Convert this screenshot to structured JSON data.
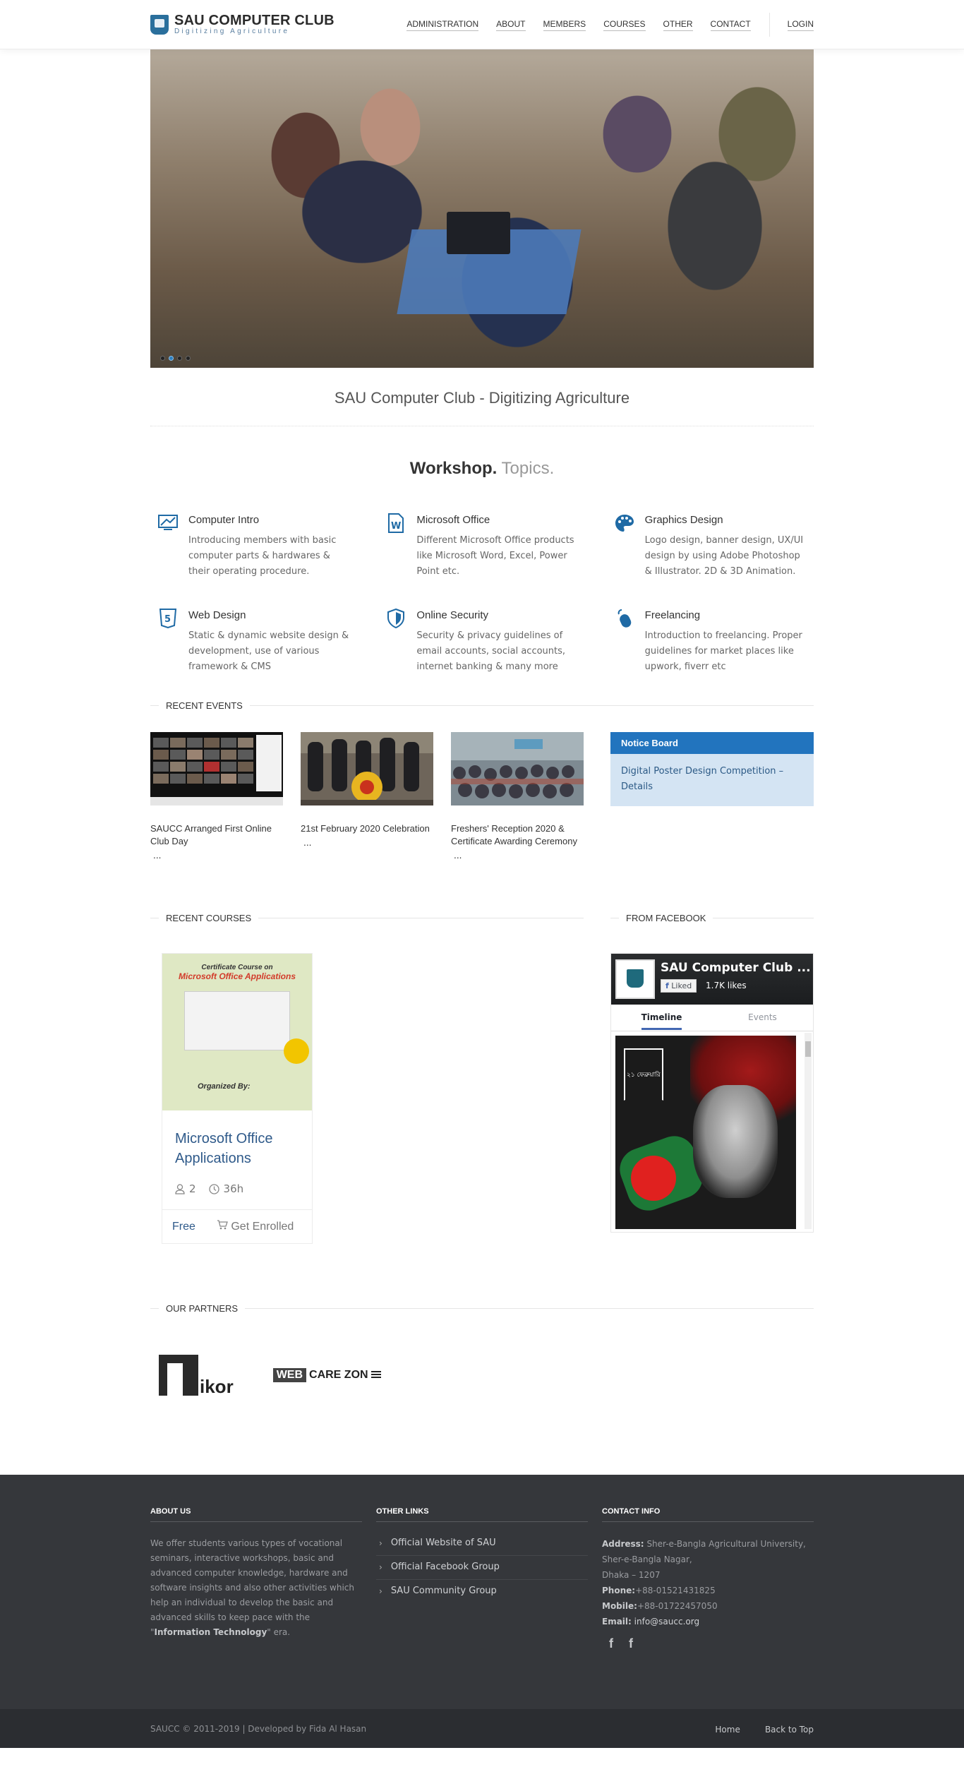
{
  "header": {
    "logo_title": "SAU COMPUTER CLUB",
    "logo_subtitle": "Digitizing Agriculture",
    "nav": [
      "ADMINISTRATION",
      "ABOUT",
      "MEMBERS",
      "COURSES",
      "OTHER",
      "CONTACT"
    ],
    "login": "LOGIN"
  },
  "hero": {
    "slide_count": 4,
    "active_slide": 2,
    "tagline": "SAU Computer Club - Digitizing Agriculture"
  },
  "workshop": {
    "title_bold": "Workshop.",
    "title_light": "Topics.",
    "topics": [
      {
        "icon": "monitor-icon",
        "title": "Computer Intro",
        "desc": "Introducing members with basic computer parts & hardwares & their operating procedure."
      },
      {
        "icon": "word-document-icon",
        "title": "Microsoft Office",
        "desc": "Different Microsoft Office products like Microsoft Word, Excel, Power Point etc."
      },
      {
        "icon": "palette-icon",
        "title": "Graphics Design",
        "desc": "Logo design, banner design, UX/UI design by using Adobe Photoshop & Illustrator. 2D & 3D Animation."
      },
      {
        "icon": "html5-icon",
        "title": "Web Design",
        "desc": "Static & dynamic website design & development, use of various framework & CMS"
      },
      {
        "icon": "shield-icon",
        "title": "Online Security",
        "desc": "Security & privacy guidelines of email accounts, social accounts, internet banking & many more"
      },
      {
        "icon": "mouse-icon",
        "title": "Freelancing",
        "desc": "Introduction to freelancing. Proper guidelines for market places like upwork, fiverr etc"
      }
    ]
  },
  "events": {
    "heading": "RECENT EVENTS",
    "items": [
      {
        "title": "SAUCC Arranged First Online Club Day",
        "more": "..."
      },
      {
        "title": "21st February 2020 Celebration",
        "more": "..."
      },
      {
        "title": "Freshers' Reception 2020 & Certificate Awarding Ceremony",
        "more": "..."
      }
    ],
    "notice_title": "Notice Board",
    "notice_item": "Digital Poster Design Competition – Details"
  },
  "courses": {
    "heading": "RECENT COURSES",
    "card": {
      "poster_line1": "Certificate Course on",
      "poster_line2": "Microsoft Office Applications",
      "poster_org": "Organized By:",
      "title": "Microsoft Office Applications",
      "students": "2",
      "duration": "36h",
      "price": "Free",
      "enroll": "Get Enrolled"
    }
  },
  "facebook": {
    "heading": "FROM FACEBOOK",
    "page_name": "SAU Computer Club ...",
    "liked_label": "Liked",
    "likes": "1.7K likes",
    "tabs": [
      "Timeline",
      "Events"
    ],
    "post_text": "২১ ফেব্রুয়ারি"
  },
  "partners": {
    "heading": "OUR PARTNERS",
    "nikor": "ikor",
    "webcare_badge": "WEB",
    "webcare_text": "CARE ZON"
  },
  "footer": {
    "about_heading": "ABOUT US",
    "about_text_1": "We offer students various types of vocational seminars, interactive workshops, basic and advanced computer knowledge, hardware and software insights and also other activities which help an individual to develop the basic and advanced skills to keep pace with the \"",
    "about_bold": "Information Technology",
    "about_text_2": "\" era.",
    "links_heading": "OTHER LINKS",
    "links": [
      "Official Website of SAU",
      "Official Facebook Group",
      "SAU Community Group"
    ],
    "contact_heading": "CONTACT INFO",
    "address_label": "Address:",
    "address_1": "Sher-e-Bangla Agricultural University,",
    "address_2": "Sher-e-Bangla Nagar,",
    "address_3": "Dhaka – 1207",
    "phone_label": "Phone:",
    "phone": "+88-01521431825",
    "mobile_label": "Mobile:",
    "mobile": "+88-01722457050",
    "email_label": "Email:",
    "email": "info@saucc.org",
    "social": [
      "f",
      "f"
    ]
  },
  "bottom": {
    "copyright": "SAUCC © 2011-2019 | Developed by Fida Al Hasan",
    "home": "Home",
    "back_to_top": "Back to Top"
  },
  "colors": {
    "accent": "#2274be",
    "footer_bg": "#35373b",
    "bottom_bg": "#2b2d31"
  }
}
